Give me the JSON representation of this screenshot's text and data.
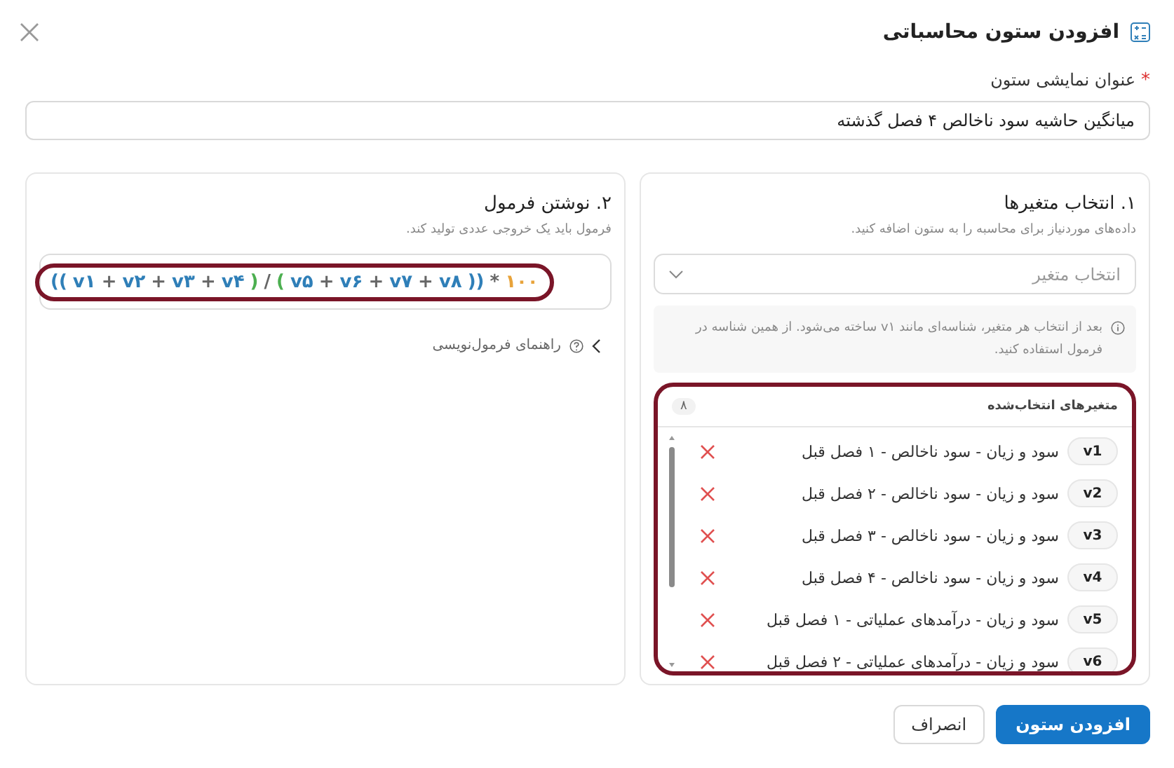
{
  "dialog": {
    "title": "افزودن ستون محاسباتی"
  },
  "column_title": {
    "label": "عنوان نمایشی ستون",
    "required": true,
    "value": "میانگین حاشیه سود ناخالص ۴ فصل گذشته"
  },
  "variables_panel": {
    "heading": "۱. انتخاب متغیرها",
    "description": "داده‌های موردنیاز برای محاسبه را به ستون اضافه کنید.",
    "select": {
      "placeholder": "انتخاب متغیر"
    },
    "hint": "بعد از انتخاب هر متغیر، شناسه‌ای مانند v۱ ساخته می‌شود. از همین شناسه در فرمول استفاده کنید.",
    "highlighted": true,
    "selected_list": {
      "title": "متغیرهای انتخاب‌شده",
      "count": "۸",
      "items": [
        {
          "id": "v1",
          "name": "سود و زیان - سود ناخالص - ۱ فصل قبل"
        },
        {
          "id": "v2",
          "name": "سود و زیان - سود ناخالص - ۲ فصل قبل"
        },
        {
          "id": "v3",
          "name": "سود و زیان - سود ناخالص - ۳ فصل قبل"
        },
        {
          "id": "v4",
          "name": "سود و زیان - سود ناخالص - ۴ فصل قبل"
        },
        {
          "id": "v5",
          "name": "سود و زیان - درآمدهای عملیاتی - ۱ فصل قبل"
        },
        {
          "id": "v6",
          "name": "سود و زیان - درآمدهای عملیاتی - ۲ فصل قبل"
        }
      ]
    }
  },
  "formula_panel": {
    "heading": "۲. نوشتن فرمول",
    "description": "فرمول باید یک خروجی عددی تولید کند.",
    "highlighted": true,
    "formula": [
      {
        "text": "۱۰۰",
        "color": "#e8a33a"
      },
      {
        "text": "*",
        "color": "#666666"
      },
      {
        "text": "))",
        "color": "#2f7fb8"
      },
      {
        "text": "v۸",
        "color": "#2f7fb8"
      },
      {
        "text": "+",
        "color": "#666666"
      },
      {
        "text": "v۷",
        "color": "#2f7fb8"
      },
      {
        "text": "+",
        "color": "#666666"
      },
      {
        "text": "v۶",
        "color": "#2f7fb8"
      },
      {
        "text": "+",
        "color": "#666666"
      },
      {
        "text": "v۵",
        "color": "#2f7fb8"
      },
      {
        "text": "(",
        "color": "#4caf50"
      },
      {
        "text": "/",
        "color": "#666666"
      },
      {
        "text": ")",
        "color": "#4caf50"
      },
      {
        "text": "v۴",
        "color": "#2f7fb8"
      },
      {
        "text": "+",
        "color": "#666666"
      },
      {
        "text": "v۳",
        "color": "#2f7fb8"
      },
      {
        "text": "+",
        "color": "#666666"
      },
      {
        "text": "v۲",
        "color": "#2f7fb8"
      },
      {
        "text": "+",
        "color": "#666666"
      },
      {
        "text": "v۱",
        "color": "#2f7fb8"
      },
      {
        "text": "((",
        "color": "#2f7fb8"
      }
    ],
    "guide_link": "راهنمای فرمول‌نویسی"
  },
  "buttons": [
    {
      "label": "افزودن ستون",
      "kind": "primary"
    },
    {
      "label": "انصراف",
      "kind": "secondary"
    }
  ]
}
